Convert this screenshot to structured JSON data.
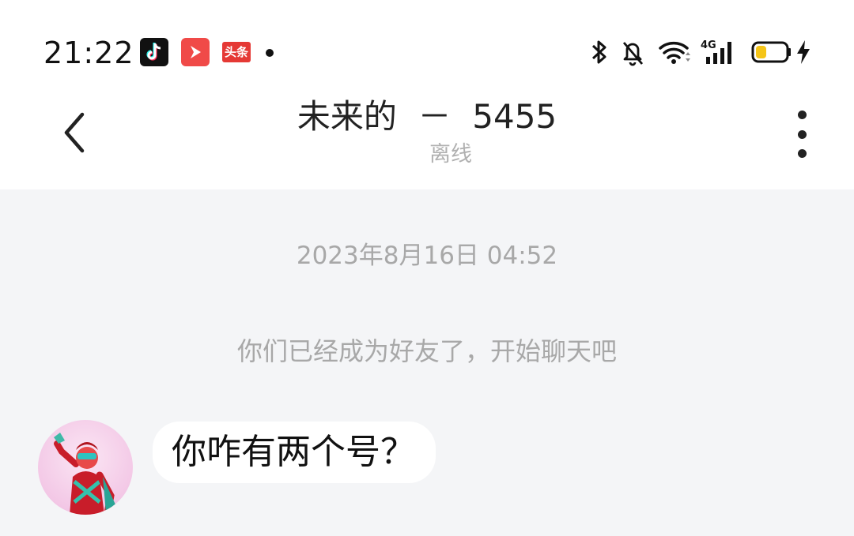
{
  "status_bar": {
    "time": "21:22",
    "toutiao_label": "头条",
    "network_label": "4G",
    "battery_color": "#f5c518",
    "icons": [
      "tiktok-icon",
      "video-app-icon",
      "toutiao-icon",
      "bluetooth-icon",
      "bell-off-icon",
      "wifi-icon",
      "signal-icon",
      "battery-icon",
      "charging-icon"
    ]
  },
  "header": {
    "title": "未来的  －  5455",
    "status": "离线",
    "back_icon": "chevron-left-icon",
    "more_icon": "more-vertical-icon"
  },
  "chat": {
    "timestamp": "2023年8月16日 04:52",
    "system_notice": "你们已经成为好友了，开始聊天吧",
    "messages": [
      {
        "sender": "other",
        "text": "你咋有两个号？"
      }
    ]
  },
  "colors": {
    "chat_background": "#f4f5f7",
    "muted_text": "#a8a8a8",
    "bubble": "#ffffff"
  }
}
